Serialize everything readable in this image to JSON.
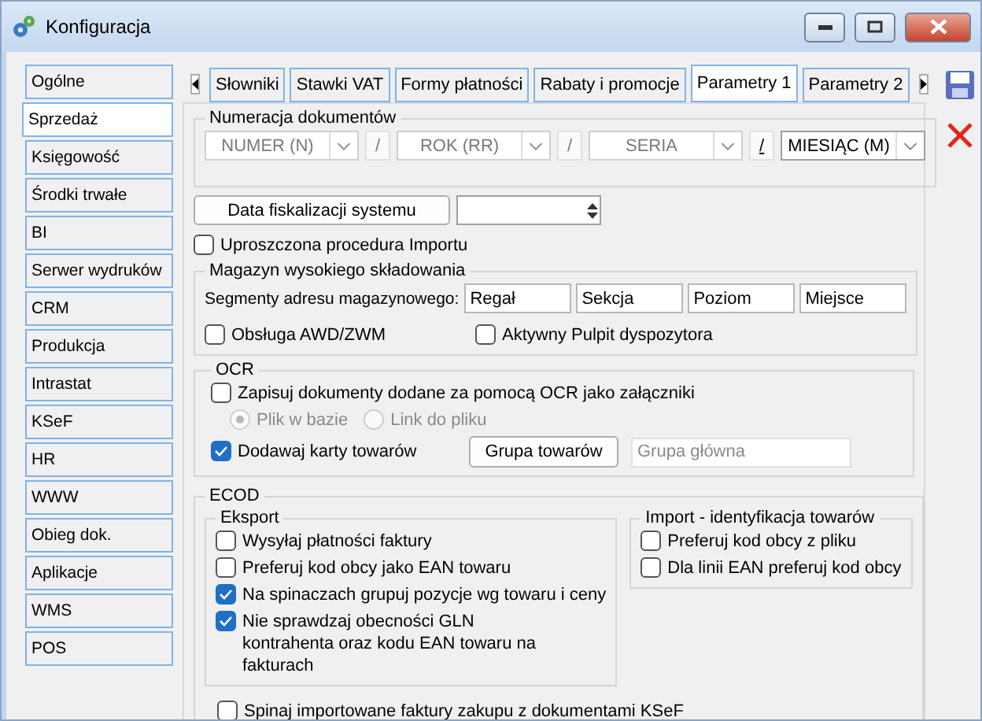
{
  "window": {
    "title": "Konfiguracja"
  },
  "sidebar": {
    "items": [
      {
        "label": "Ogólne",
        "selected": false
      },
      {
        "label": "Sprzedaż",
        "selected": true
      },
      {
        "label": "Księgowość",
        "selected": false
      },
      {
        "label": "Środki trwałe",
        "selected": false
      },
      {
        "label": "BI",
        "selected": false
      },
      {
        "label": "Serwer wydruków",
        "selected": false
      },
      {
        "label": "CRM",
        "selected": false
      },
      {
        "label": "Produkcja",
        "selected": false
      },
      {
        "label": "Intrastat",
        "selected": false
      },
      {
        "label": "KSeF",
        "selected": false
      },
      {
        "label": "HR",
        "selected": false
      },
      {
        "label": "WWW",
        "selected": false
      },
      {
        "label": "Obieg dok.",
        "selected": false
      },
      {
        "label": "Aplikacje",
        "selected": false
      },
      {
        "label": "WMS",
        "selected": false
      },
      {
        "label": "POS",
        "selected": false
      }
    ]
  },
  "tabs": [
    {
      "label": "Słowniki",
      "selected": false
    },
    {
      "label": "Stawki VAT",
      "selected": false
    },
    {
      "label": "Formy płatności",
      "selected": false
    },
    {
      "label": "Rabaty i promocje",
      "selected": false
    },
    {
      "label": "Parametry 1",
      "selected": true
    },
    {
      "label": "Parametry 2",
      "selected": false
    }
  ],
  "numeracja": {
    "title": "Numeracja dokumentów",
    "segments": [
      {
        "kind": "combo",
        "value": "NUMER (N)",
        "disabled": true
      },
      {
        "kind": "separator",
        "value": "/",
        "disabled": true
      },
      {
        "kind": "combo",
        "value": "ROK (RR)",
        "disabled": true
      },
      {
        "kind": "separator",
        "value": "/",
        "disabled": true
      },
      {
        "kind": "combo",
        "value": "SERIA",
        "disabled": true
      },
      {
        "kind": "separator",
        "value": "/",
        "disabled": false
      },
      {
        "kind": "combo",
        "value": "MIESIĄC (M)",
        "disabled": false
      }
    ]
  },
  "fiskalizacja": {
    "button": "Data fiskalizacji systemu"
  },
  "uproszczona": {
    "label": "Uproszczona procedura Importu",
    "checked": false
  },
  "magazyn": {
    "title": "Magazyn wysokiego składowania",
    "segments_label": "Segmenty adresu magazynowego:",
    "segments": [
      "Regał",
      "Sekcja",
      "Poziom",
      "Miejsce"
    ],
    "options": [
      {
        "label": "Obsługa AWD/ZWM",
        "checked": false
      },
      {
        "label": "Aktywny Pulpit dyspozytora",
        "checked": false
      }
    ]
  },
  "ocr": {
    "title": "OCR",
    "save": {
      "label": "Zapisuj dokumenty dodane za pomocą OCR jako załączniki",
      "checked": false
    },
    "storage": [
      {
        "label": "Plik w bazie",
        "selected": true,
        "disabled": true
      },
      {
        "label": "Link do pliku",
        "selected": false,
        "disabled": true
      }
    ],
    "cards": {
      "label": "Dodawaj karty towarów",
      "checked": true
    },
    "group_button": "Grupa towarów",
    "group_value": "Grupa główna"
  },
  "ecod": {
    "title": "ECOD",
    "eksport": {
      "title": "Eksport",
      "options": [
        {
          "label": "Wysyłaj płatności faktury",
          "checked": false
        },
        {
          "label": "Preferuj kod obcy jako EAN towaru",
          "checked": false
        },
        {
          "label": "Na spinaczach grupuj pozycje wg towaru i ceny",
          "checked": true
        },
        {
          "label": "Nie sprawdzaj obecności GLN kontrahenta oraz kodu EAN towaru na fakturach",
          "checked": true
        }
      ]
    },
    "import": {
      "title": "Import - identyfikacja towarów",
      "options": [
        {
          "label": "Preferuj kod obcy z pliku",
          "checked": false
        },
        {
          "label": "Dla linii EAN preferuj kod obcy",
          "checked": false
        }
      ]
    },
    "spinaj": {
      "label": "Spinaj importowane faktury zakupu z dokumentami KSeF",
      "checked": false
    }
  }
}
